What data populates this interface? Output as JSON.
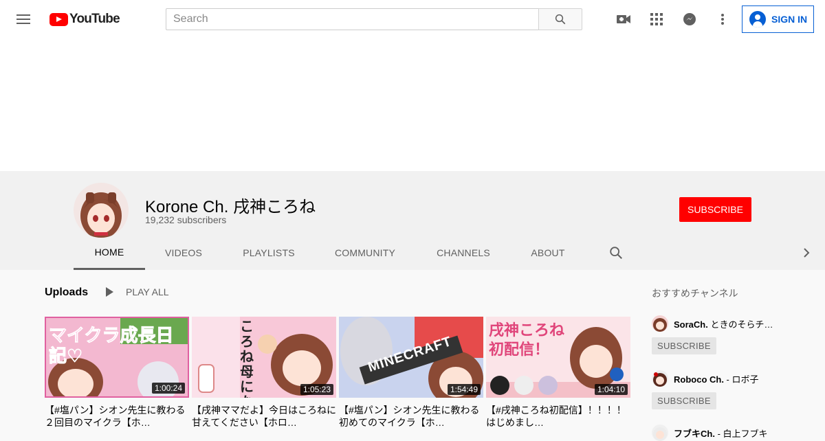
{
  "header": {
    "logo_text": "YouTube",
    "search_placeholder": "Search",
    "sign_in_label": "SIGN IN",
    "icons": [
      "menu-icon",
      "search-icon",
      "create-video-icon",
      "apps-grid-icon",
      "messages-icon",
      "more-vert-icon",
      "account-icon"
    ]
  },
  "channel": {
    "title": "Korone Ch. 戌神ころね",
    "subscribers": "19,232 subscribers",
    "subscribe_label": "SUBSCRIBE",
    "tabs": [
      {
        "label": "HOME",
        "active": true
      },
      {
        "label": "VIDEOS",
        "active": false
      },
      {
        "label": "PLAYLISTS",
        "active": false
      },
      {
        "label": "COMMUNITY",
        "active": false
      },
      {
        "label": "CHANNELS",
        "active": false
      },
      {
        "label": "ABOUT",
        "active": false
      }
    ]
  },
  "uploads": {
    "title": "Uploads",
    "play_all_label": "PLAY ALL",
    "videos": [
      {
        "title": "【#塩パン】シオン先生に教わる２回目のマイクラ【ホ…",
        "duration": "1:00:24",
        "thumb_text": "マイクラ成長日記♡"
      },
      {
        "title": "【戌神ママだよ】今日はころねに甘えてください【ホロ…",
        "duration": "1:05:23",
        "thumb_text": "ころね母になりたい"
      },
      {
        "title": "【#塩パン】シオン先生に教わる初めてのマイクラ【ホ…",
        "duration": "1:54:49",
        "thumb_text": "MINECRAFT"
      },
      {
        "title": "【#戌神ころね初配信】！！！！はじめまし…",
        "duration": "1:04:10",
        "thumb_text": "戌神ころね初配信！"
      }
    ]
  },
  "sidebar": {
    "title": "おすすめチャンネル",
    "channels": [
      {
        "name_bold": "SoraCh.",
        "name_rest": " ときのそらチ…",
        "subscribe_label": "SUBSCRIBE"
      },
      {
        "name_bold": "Roboco Ch.",
        "name_rest": " - ロボ子",
        "subscribe_label": "SUBSCRIBE"
      },
      {
        "name_bold": "フブキCh.",
        "name_rest": " - 白上フブキ",
        "subscribe_label": ""
      }
    ]
  },
  "colors": {
    "brand_red": "#ff0000",
    "link_blue": "#065fd4",
    "header_bg": "#f1f1f1"
  }
}
